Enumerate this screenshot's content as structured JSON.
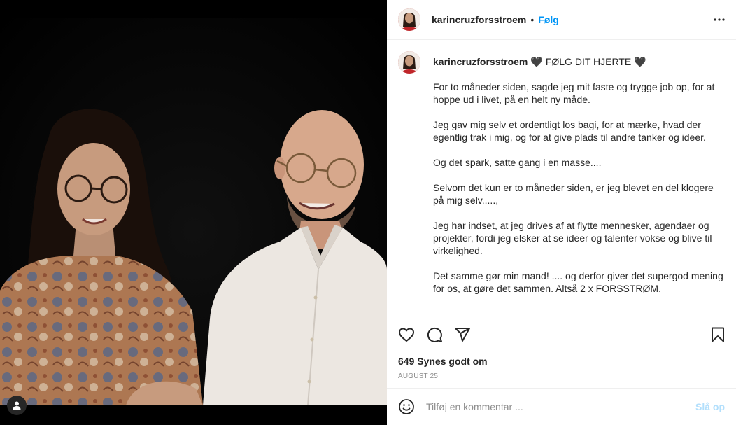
{
  "header": {
    "username": "karincruzforsstroem",
    "separator": "•",
    "follow_label": "Følg"
  },
  "caption": {
    "username": "karincruzforsstroem",
    "heart_left": "🖤",
    "headline": "FØLG DIT HJERTE",
    "heart_right": "🖤",
    "paragraphs": [
      "For to måneder siden, sagde jeg mit faste og trygge job op, for at hoppe ud i livet, på en helt ny måde.",
      "Jeg gav mig selv et ordentligt los bagi, for at mærke, hvad der egentlig trak i mig, og for at give plads til andre tanker og ideer.",
      "Og det spark, satte gang i en masse....",
      "Selvom det kun er to måneder siden, er jeg blevet en del klogere på mig selv.....,",
      "Jeg har indset, at jeg drives af at flytte mennesker, agendaer og projekter, fordi jeg elsker at se ideer og talenter vokse og blive til virkelighed.",
      "Det samme gør min mand! .... og derfor giver det supergod mening for os, at gøre det sammen. Altså 2 x FORSSTRØM."
    ]
  },
  "actions": {
    "like_icon": "heart-outline-icon",
    "comment_icon": "comment-bubble-icon",
    "share_icon": "paper-plane-icon",
    "save_icon": "bookmark-icon"
  },
  "likes_text": "649 Synes godt om",
  "date_text": "AUGUST 25",
  "comment": {
    "placeholder": "Tilføj en kommentar ...",
    "post_label": "Slå op"
  },
  "colors": {
    "accent": "#0095f6",
    "post_disabled": "#b2dffc",
    "muted": "#8e8e8e",
    "text": "#262626"
  }
}
